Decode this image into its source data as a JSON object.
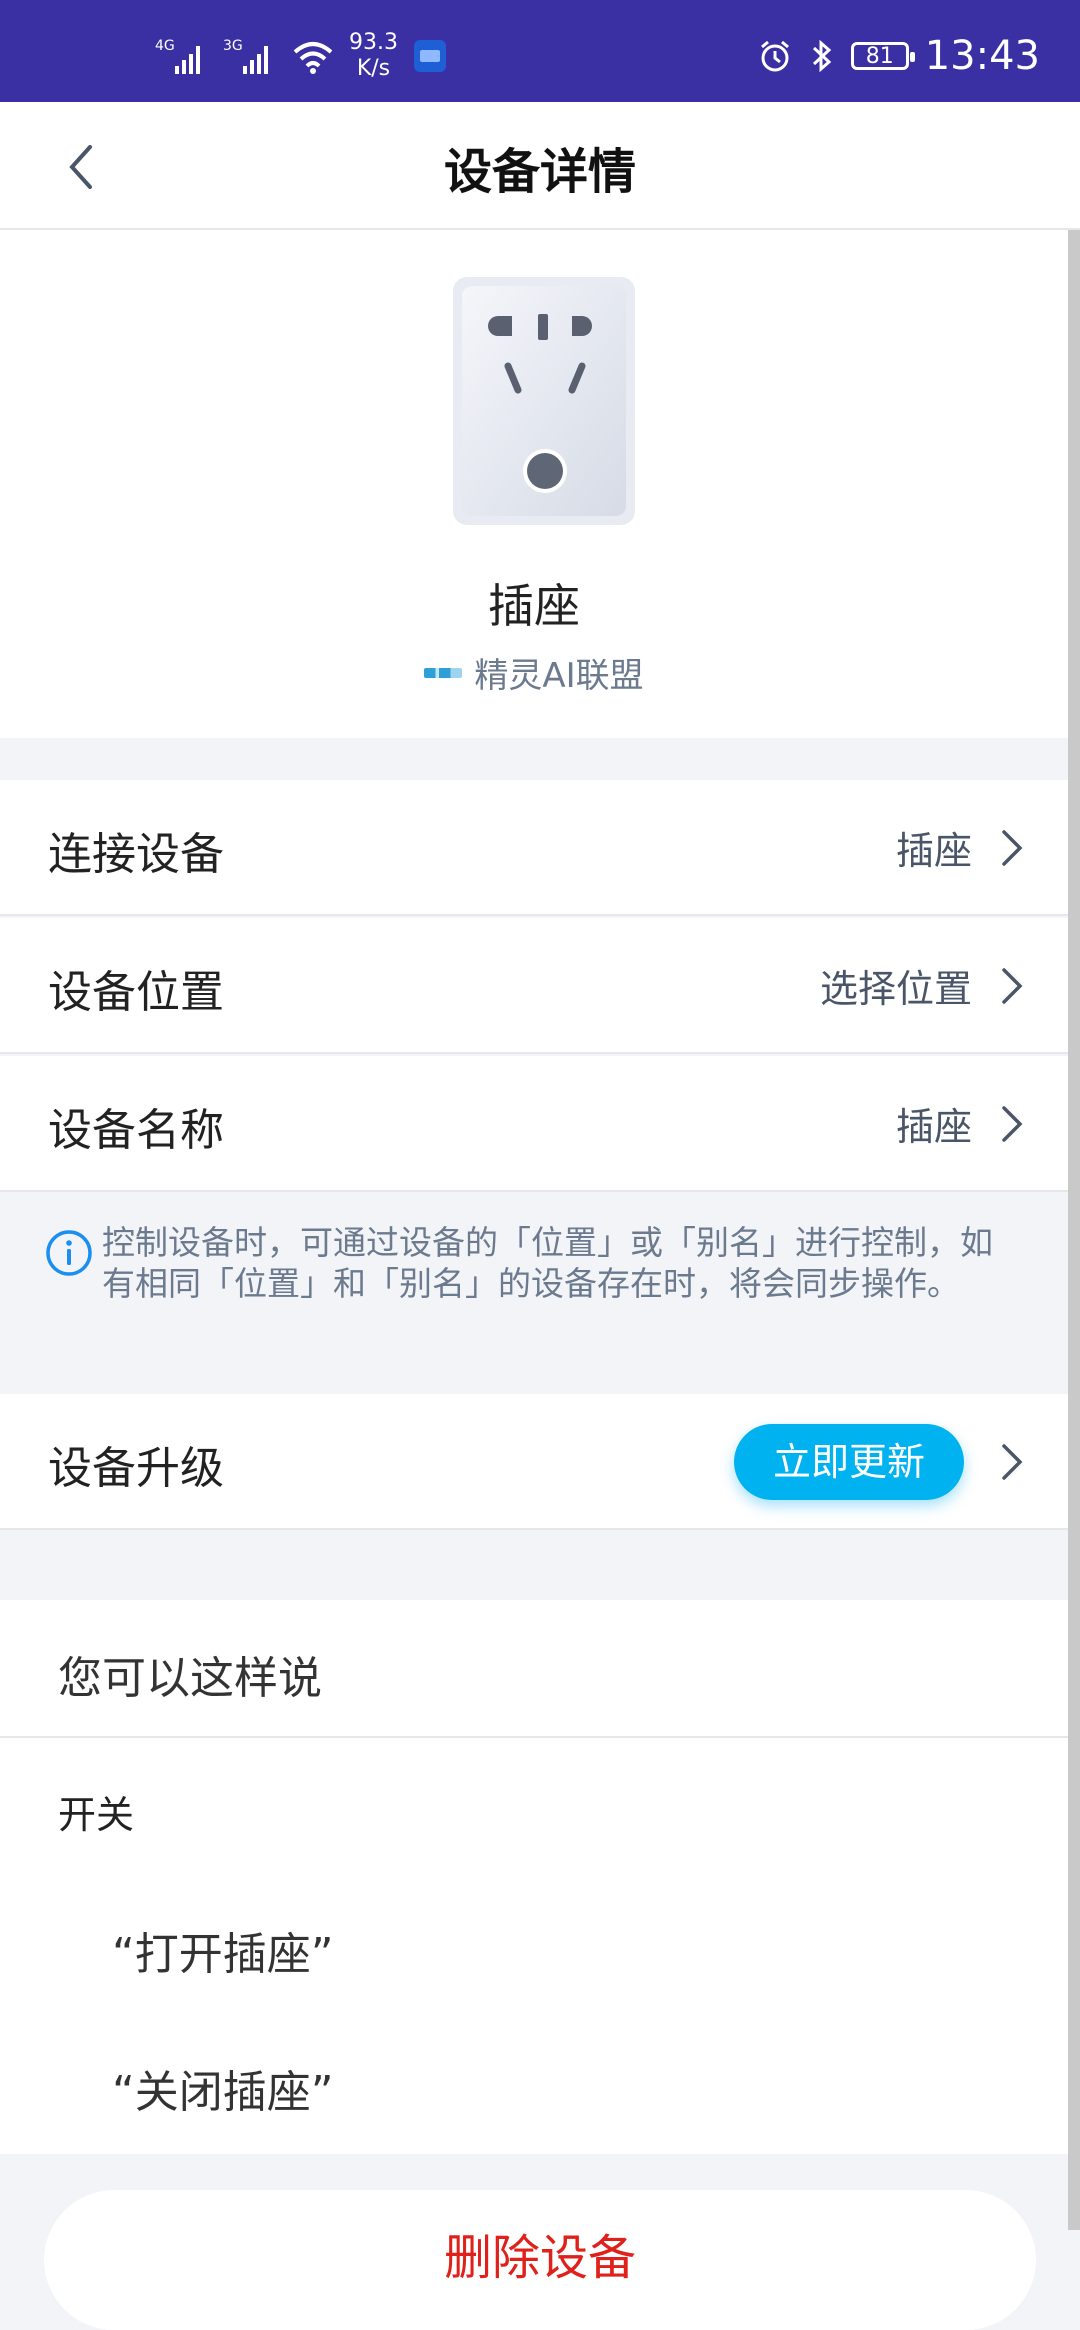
{
  "status_bar": {
    "net1": "4G",
    "net2": "3G",
    "speed_value": "93.3",
    "speed_unit": "K/s",
    "battery": "81",
    "time": "13:43",
    "icons": [
      "signal-icon",
      "wifi-icon",
      "app-icon",
      "alarm-icon",
      "bluetooth-icon",
      "battery-icon"
    ]
  },
  "header": {
    "title": "设备详情",
    "back_icon": "chevron-left-icon"
  },
  "device": {
    "name": "插座",
    "brand": "精灵AI联盟",
    "image": "power-socket"
  },
  "rows": {
    "connect": {
      "label": "连接设备",
      "value": "插座"
    },
    "location": {
      "label": "设备位置",
      "value": "选择位置"
    },
    "name": {
      "label": "设备名称",
      "value": "插座"
    }
  },
  "note": {
    "text": "控制设备时，可通过设备的「位置」或「别名」进行控制，如有相同「位置」和「别名」的设备存在时，将会同步操作。",
    "icon": "info-icon"
  },
  "upgrade": {
    "label": "设备升级",
    "button": "立即更新"
  },
  "suggestions": {
    "title": "您可以这样说",
    "category": "开关",
    "examples": [
      "“打开插座”",
      "“关闭插座”"
    ]
  },
  "delete_button": "删除设备",
  "colors": {
    "status_bar": "#3a2fa3",
    "accent": "#00b3f0",
    "danger": "#e0201b",
    "background": "#f3f4f7"
  }
}
